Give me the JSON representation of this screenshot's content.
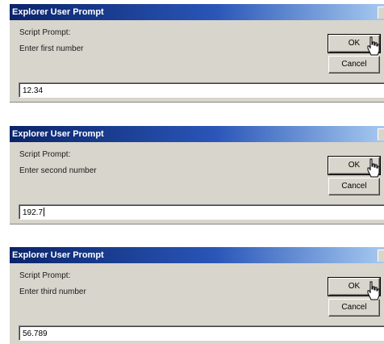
{
  "dialogs": [
    {
      "title": "Explorer User Prompt",
      "label": "Script Prompt:",
      "message": "Enter first number",
      "ok_label": "OK",
      "cancel_label": "Cancel",
      "value": "12.34"
    },
    {
      "title": "Explorer User Prompt",
      "label": "Script Prompt:",
      "message": "Enter second number",
      "ok_label": "OK",
      "cancel_label": "Cancel",
      "value": "192.7"
    },
    {
      "title": "Explorer User Prompt",
      "label": "Script Prompt:",
      "message": "Enter third number",
      "ok_label": "OK",
      "cancel_label": "Cancel",
      "value": "56.789"
    }
  ],
  "colors": {
    "titlebar_start": "#0a246a",
    "titlebar_end": "#a6caf0",
    "dialog_face": "#d8d5cc"
  },
  "icons": {
    "pointer": "hand-pointer-icon"
  }
}
